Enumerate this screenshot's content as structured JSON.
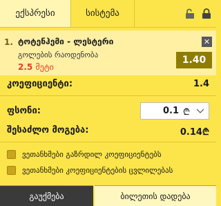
{
  "tabs": [
    {
      "label": "ექსპრესი",
      "active": true
    },
    {
      "label": "სისტემა",
      "active": false
    }
  ],
  "icons": [
    "unlock-icon",
    "lock-icon",
    "close-icon",
    "chevron-down-icon",
    "lari-currency-icon"
  ],
  "bet": {
    "number": "1.",
    "teams": "ტოტენჰემი - ლესტერი",
    "market": "გოლების რაოდენობა",
    "line_value": "2.5",
    "line_unit": "მეტი",
    "odd": "1.40"
  },
  "coefficient": {
    "label": "კოეფიციენტი:",
    "value": "1.4"
  },
  "stake": {
    "label": "ფსონი:",
    "value": "0.1",
    "currency_symbol": "₾"
  },
  "possible_win": {
    "label": "შესაძლო მოგება:",
    "value": "0.14₾"
  },
  "options": [
    "ვეთანხმები გაზრდილ კოეფიციენტებს",
    "ვეთანხმები კოეფიციენტების ცვლილებას"
  ],
  "buttons": {
    "clear": "გაუქმება",
    "place": "ბილეთის დადება"
  },
  "colors": {
    "background": "#fce54a",
    "odd_box": "#8e7d00",
    "line_value": "#e33d2b"
  }
}
